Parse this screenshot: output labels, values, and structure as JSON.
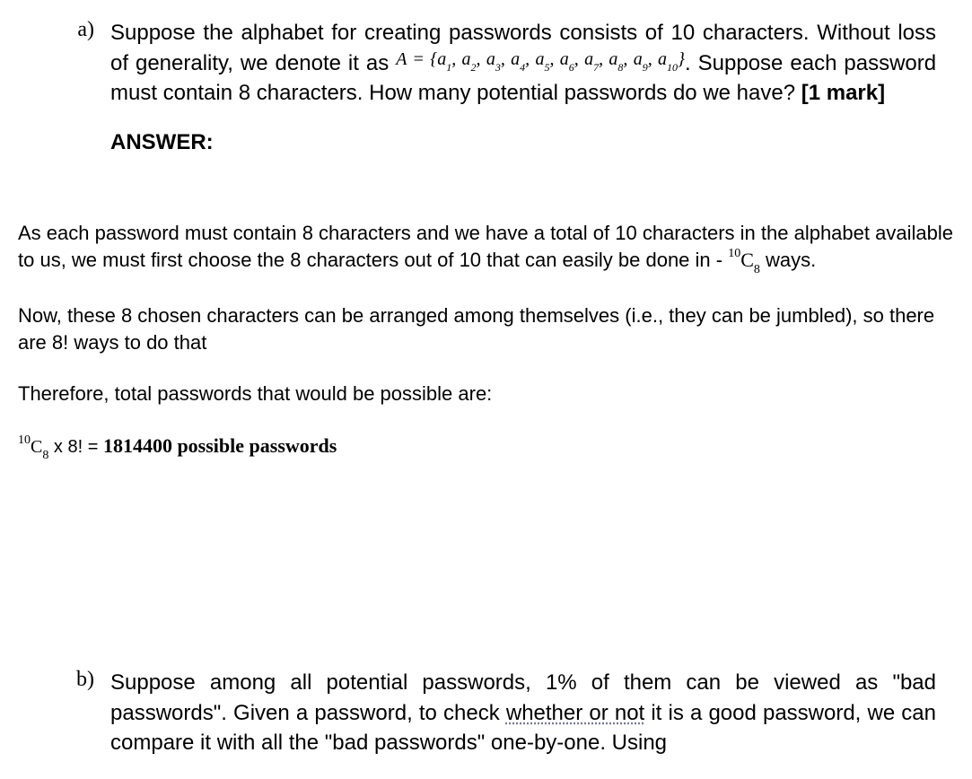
{
  "question_a": {
    "marker": "a)",
    "text_part1": "Suppose the alphabet for creating passwords consists of 10 characters. Without loss of generality, we denote it as ",
    "math_set": "A = {a₁, a₂, a₃, a₄, a₅, a₆, a₇, a₈, a₉, a₁₀}",
    "text_part2": ". Suppose each password must contain 8 characters. How many potential passwords do we have? ",
    "mark": "[1 mark]",
    "answer_label": "ANSWER:"
  },
  "answer_a": {
    "para1_part1": "As each password must contain 8 characters and we have a total of 10 characters in the alphabet available to us, we must first choose the 8 characters out of 10 that can easily be done in - ",
    "comb_sup": "10",
    "comb_main": "C",
    "comb_sub": "8",
    "para1_part2": " ways.",
    "para2": "Now, these 8 chosen characters can be arranged among themselves (i.e., they can be jumbled), so there are 8! ways to do that",
    "para3": "Therefore, total passwords that would be possible are:",
    "final_comb_sup": "10",
    "final_comb_main": "C",
    "final_comb_sub": "8",
    "final_times": " x 8! = ",
    "final_result": "1814400 possible passwords"
  },
  "question_b": {
    "marker": "b)",
    "text_part1": "Suppose among all potential passwords, 1% of them can be viewed as \"bad passwords\". Given a password, to check ",
    "underlined": "whether or not",
    "text_part2": " it is a good password, we can compare it with all the \"bad passwords\" one-by-one. Using"
  }
}
